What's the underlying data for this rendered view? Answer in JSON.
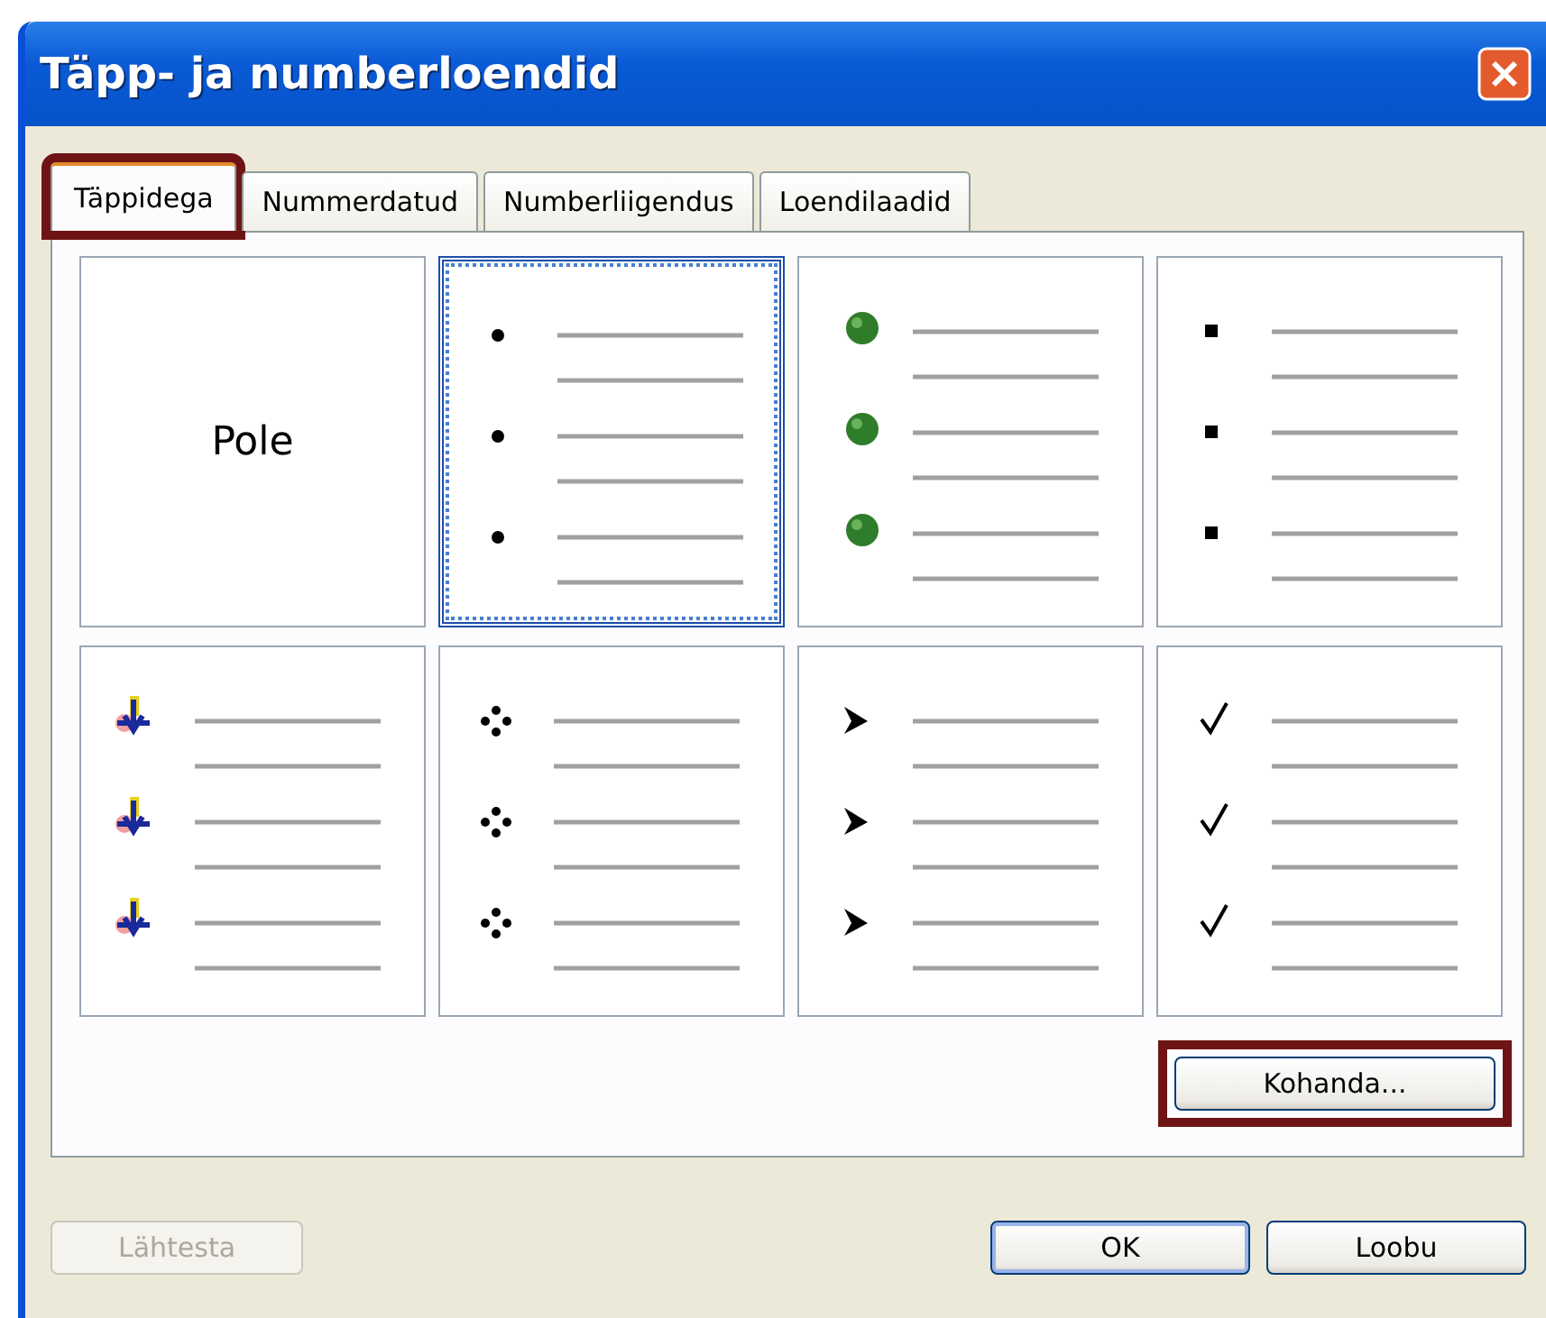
{
  "window": {
    "title": "Täpp- ja numberloendid"
  },
  "tabs": [
    {
      "label": "Täppidega",
      "selected": true,
      "highlighted": true
    },
    {
      "label": "Nummerdatud",
      "selected": false,
      "highlighted": false
    },
    {
      "label": "Numberliigendus",
      "selected": false,
      "highlighted": false
    },
    {
      "label": "Loendilaadid",
      "selected": false,
      "highlighted": false
    }
  ],
  "cells": [
    {
      "kind": "none",
      "label": "Pole",
      "selected": false
    },
    {
      "kind": "dot",
      "selected": true
    },
    {
      "kind": "ball",
      "selected": false
    },
    {
      "kind": "square",
      "selected": false
    },
    {
      "kind": "arrow",
      "selected": false
    },
    {
      "kind": "four-dots",
      "selected": false
    },
    {
      "kind": "arrowhead",
      "selected": false
    },
    {
      "kind": "check",
      "selected": false
    }
  ],
  "customize_button": {
    "label": "Kohanda...",
    "highlighted": true
  },
  "buttons": [
    {
      "label": "Lähtesta",
      "disabled": true
    },
    {
      "label": "OK",
      "disabled": false,
      "default": true
    },
    {
      "label": "Loobu",
      "disabled": false,
      "default": false
    }
  ]
}
